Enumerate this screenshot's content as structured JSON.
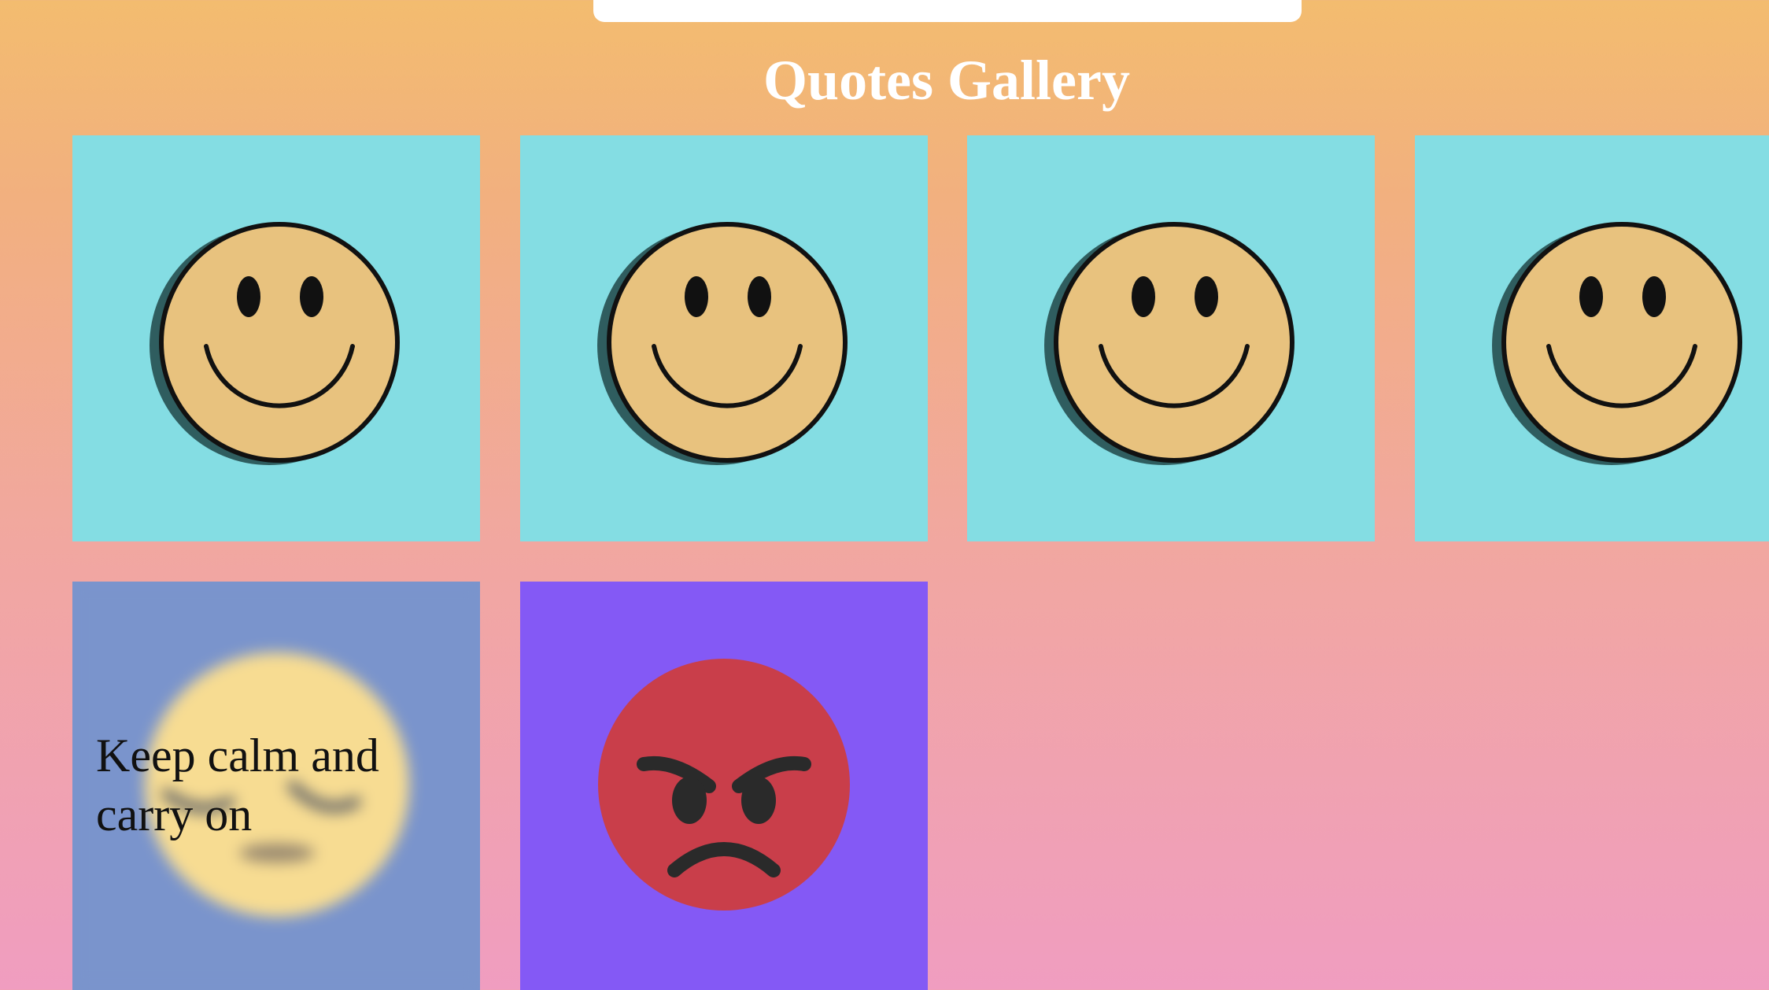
{
  "gallery": {
    "title": "Quotes Gallery"
  },
  "cards": [
    {
      "icon": "smiley-face-icon",
      "background": "#84dde3"
    },
    {
      "icon": "smiley-face-icon",
      "background": "#84dde3"
    },
    {
      "icon": "smiley-face-icon",
      "background": "#84dde3"
    },
    {
      "icon": "smiley-face-icon",
      "background": "#84dde3"
    },
    {
      "icon": "sleepy-face-icon",
      "background": "#7a94cc",
      "quote": "Keep calm and carry on"
    },
    {
      "icon": "angry-face-icon",
      "background": "#8459f5"
    }
  ],
  "colors": {
    "smiley_fill": "#e8c27e",
    "calm_face": "#f7dc92",
    "angry_face": "#c93e4a",
    "title_text": "#ffffff"
  }
}
